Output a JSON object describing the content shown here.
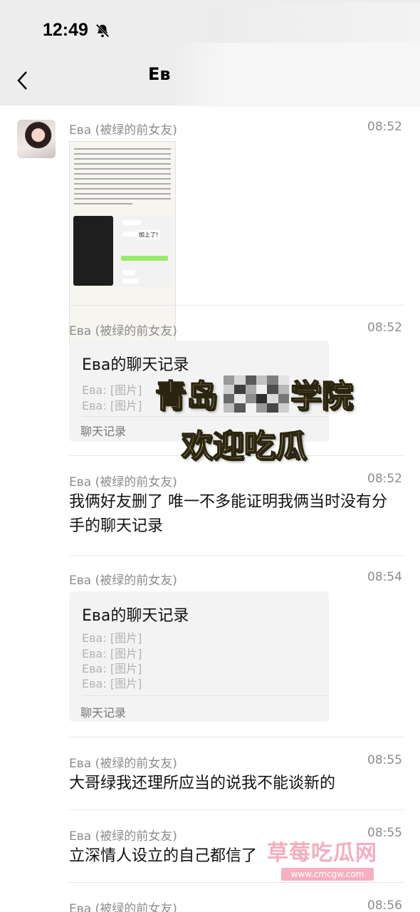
{
  "status_bar": {
    "time": "12:49"
  },
  "nav": {
    "title": "Eв"
  },
  "messages": [
    {
      "sender": "Eва (被绿的前女友)",
      "time": "08:52"
    },
    {
      "sender": "Eва (被绿的前女友)",
      "time": "08:52",
      "record": {
        "title": "Eва的聊天记录",
        "lines": [
          "Eва: [图片]",
          "Eва: [图片]"
        ],
        "footer": "聊天记录"
      }
    },
    {
      "sender": "Eва (被绿的前女友)",
      "time": "08:52",
      "text": "我俩好友删了 唯一不多能证明我俩当时没有分手的聊天记录"
    },
    {
      "sender": "Eва (被绿的前女友)",
      "time": "08:54",
      "record": {
        "title": "Eва的聊天记录",
        "lines": [
          "Eва: [图片]",
          "Eва: [图片]",
          "Eва: [图片]",
          "Eва: [图片]"
        ],
        "footer": "聊天记录"
      }
    },
    {
      "sender": "Eва (被绿的前女友)",
      "time": "08:55",
      "text": "大哥绿我还理所应当的说我不能谈新的"
    },
    {
      "sender": "Eва (被绿的前女友)",
      "time": "08:55",
      "text": "立深情人设立的自己都信了"
    },
    {
      "sender": "Eва (被绿的前女友)",
      "time": "08:56"
    }
  ],
  "image_content": {
    "tag": "加上了!"
  },
  "overlay": {
    "line1_left": "青岛",
    "line1_right": "学院",
    "line2": "欢迎吃瓜"
  },
  "watermark": {
    "name": "草莓吃瓜网",
    "url": "www.cmcgw.com"
  }
}
